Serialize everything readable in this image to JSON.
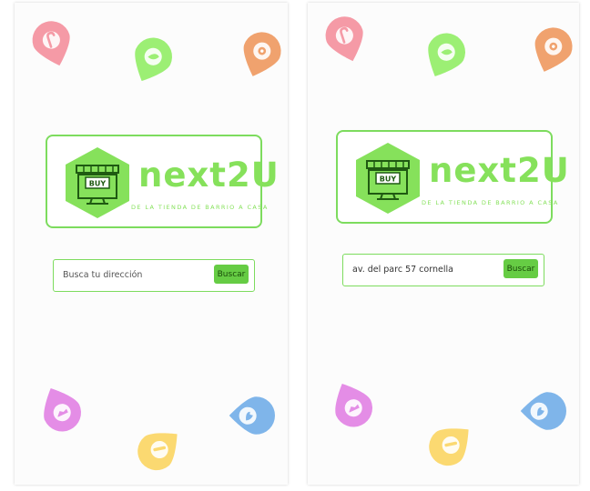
{
  "colors": {
    "brand_green": "#86e15b",
    "button_green": "#66cc44",
    "pin_pink": "#f59aa6",
    "pin_green": "#9cef74",
    "pin_orange": "#f0a26e",
    "pin_magenta": "#e48de6",
    "pin_yellow": "#fbd971",
    "pin_blue": "#7fb5ea"
  },
  "screens": [
    {
      "logo": {
        "badge_text": "BUY",
        "title": "next2U",
        "tagline": "DE LA TIENDA DE BARRIO A CASA"
      },
      "search": {
        "placeholder": "Busca tu dirección",
        "value": "",
        "button_label": "Buscar"
      },
      "pins": [
        "candy-cane-icon",
        "leaf-icon",
        "flower-icon",
        "shoe-icon",
        "pharmacy-icon",
        "fish-icon"
      ]
    },
    {
      "logo": {
        "badge_text": "BUY",
        "title": "next2U",
        "tagline": "DE LA TIENDA DE BARRIO A CASA"
      },
      "search": {
        "placeholder": "Busca tu dirección",
        "value": "av. del parc 57 cornella",
        "button_label": "Buscar"
      },
      "pins": [
        "candy-cane-icon",
        "leaf-icon",
        "flower-icon",
        "shoe-icon",
        "pharmacy-icon",
        "fish-icon"
      ]
    }
  ]
}
